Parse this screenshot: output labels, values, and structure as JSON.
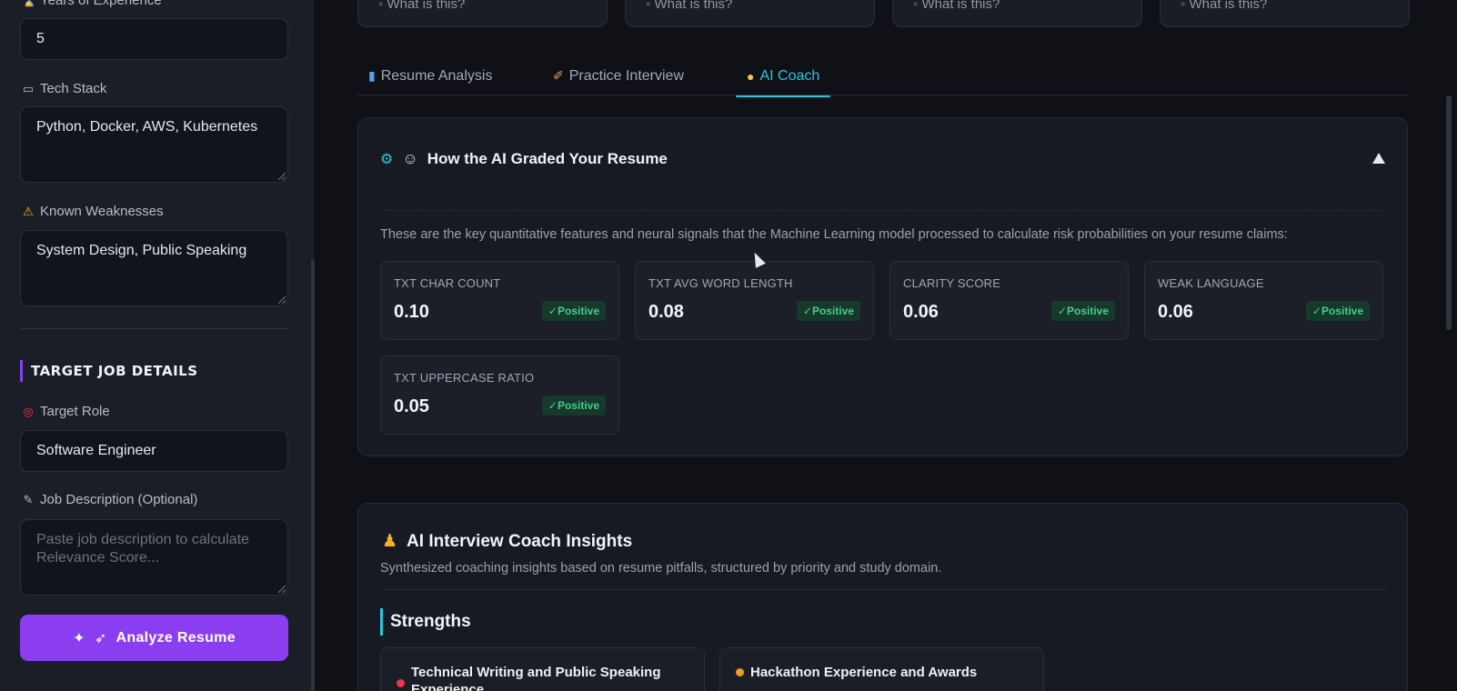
{
  "sidebar": {
    "experience": {
      "label": "Years of Experience",
      "icon": "hourglass-icon",
      "value": "5"
    },
    "tech_stack": {
      "label": "Tech Stack",
      "icon": "laptop-icon",
      "value": "Python, Docker, AWS, Kubernetes"
    },
    "weaknesses": {
      "label": "Known Weaknesses",
      "icon": "warning-icon",
      "value": "System Design, Public Speaking"
    },
    "section_title": "TARGET JOB DETAILS",
    "target_role": {
      "label": "Target Role",
      "icon": "target-icon",
      "value": "Software Engineer"
    },
    "job_description": {
      "label": "Job Description (Optional)",
      "icon": "memo-icon",
      "placeholder": "Paste job description to calculate Relevance Score..."
    },
    "analyze_button": "Analyze Resume",
    "accent": "#8b3ef0"
  },
  "top_cards": [
    "What is this?",
    "What is this?",
    "What is this?",
    "What is this?"
  ],
  "tabs": [
    {
      "label": "Resume Analysis",
      "icon": "chart-icon",
      "active": false
    },
    {
      "label": "Practice Interview",
      "icon": "microphone-icon",
      "active": false
    },
    {
      "label": "AI Coach",
      "icon": "lightbulb-icon",
      "active": true
    }
  ],
  "grading": {
    "title": "How the AI Graded Your Resume",
    "description": "These are the key quantitative features and neural signals that the Machine Learning model processed to calculate risk probabilities on your resume claims:",
    "metrics": [
      {
        "label": "TXT CHAR COUNT",
        "value": "0.10",
        "badge": "✓Positive"
      },
      {
        "label": "TXT AVG WORD LENGTH",
        "value": "0.08",
        "badge": "✓Positive"
      },
      {
        "label": "CLARITY SCORE",
        "value": "0.06",
        "badge": "✓Positive"
      },
      {
        "label": "WEAK LANGUAGE",
        "value": "0.06",
        "badge": "✓Positive"
      },
      {
        "label": "TXT UPPERCASE RATIO",
        "value": "0.05",
        "badge": "✓Positive"
      }
    ]
  },
  "coach": {
    "title": "AI Interview Coach Insights",
    "subtitle": "Synthesized coaching insights based on resume pitfalls, structured by priority and study domain.",
    "section": "Strengths",
    "insights": [
      {
        "text": "Technical Writing and Public Speaking Experience",
        "dot_color": "#e8384f"
      },
      {
        "text": "Hackathon Experience and Awards",
        "dot_color": "#f59a23"
      }
    ]
  },
  "colors": {
    "cyan": "#27c7e0",
    "positive": "#3fd089",
    "background": "#0f1117"
  }
}
